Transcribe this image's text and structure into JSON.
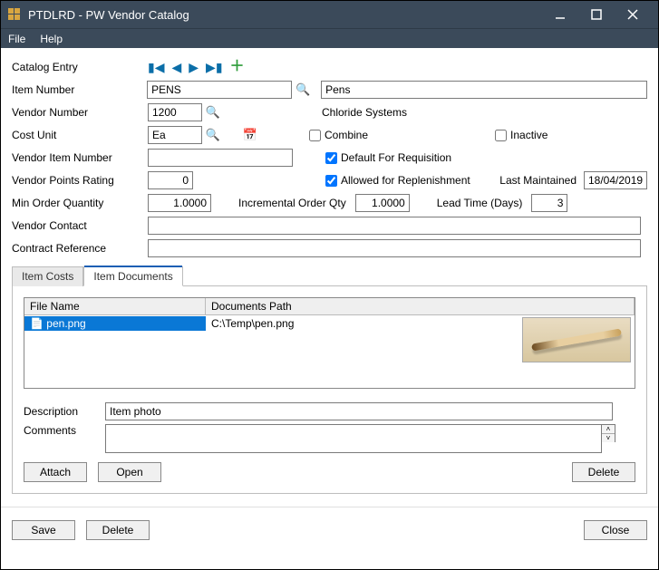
{
  "window": {
    "title": "PTDLRD - PW Vendor Catalog"
  },
  "menu": {
    "file": "File",
    "help": "Help"
  },
  "labels": {
    "catalog_entry": "Catalog Entry",
    "item_number": "Item Number",
    "vendor_number": "Vendor Number",
    "cost_unit": "Cost Unit",
    "vendor_item_number": "Vendor Item Number",
    "vendor_points_rating": "Vendor Points Rating",
    "min_order_qty": "Min Order Quantity",
    "incremental_order_qty": "Incremental Order Qty",
    "lead_time_days": "Lead Time (Days)",
    "vendor_contact": "Vendor Contact",
    "contract_reference": "Contract Reference",
    "last_maintained": "Last Maintained",
    "description": "Description",
    "comments": "Comments"
  },
  "fields": {
    "item_number": "PENS",
    "item_desc": "Pens",
    "vendor_number": "1200",
    "vendor_name": "Chloride Systems",
    "cost_unit": "Ea",
    "vendor_item_number": "",
    "vendor_points_rating": "0",
    "min_order_qty": "1.0000",
    "incremental_order_qty": "1.0000",
    "lead_time_days": "3",
    "last_maintained": "18/04/2019",
    "vendor_contact": "",
    "contract_reference": "",
    "doc_description": "Item photo",
    "doc_comments": ""
  },
  "checks": {
    "combine": "Combine",
    "inactive": "Inactive",
    "default_req": "Default For Requisition",
    "allowed_replen": "Allowed for Replenishment"
  },
  "tabs": {
    "costs": "Item Costs",
    "docs": "Item Documents"
  },
  "grid": {
    "col_file": "File Name",
    "col_path": "Documents Path",
    "row0_file": "pen.png",
    "row0_path": "C:\\Temp\\pen.png"
  },
  "buttons": {
    "attach": "Attach",
    "open": "Open",
    "delete": "Delete",
    "save": "Save",
    "close": "Close"
  }
}
